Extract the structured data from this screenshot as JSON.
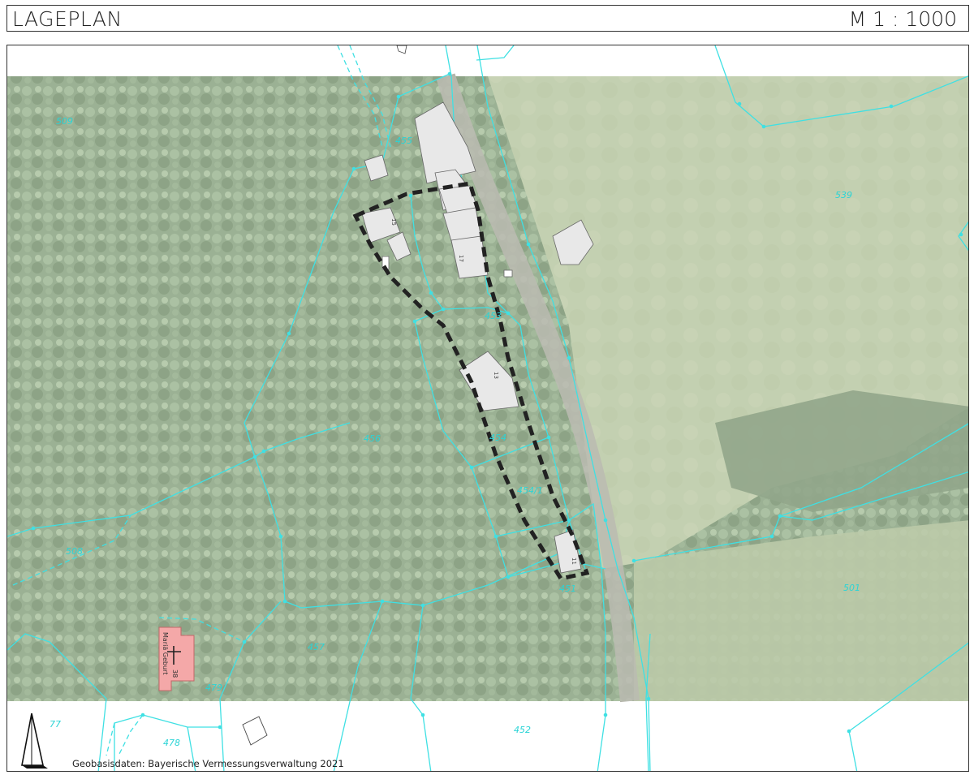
{
  "header": {
    "title": "LAGEPLAN",
    "scale": "M 1 : 1000"
  },
  "credit": "Geobasisdaten: Bayerische Vermessungsverwaltung 2021",
  "parcel_labels": [
    "509",
    "455",
    "539",
    "456",
    "454",
    "454/1",
    "501",
    "508",
    "457",
    "479",
    "478",
    "77",
    "452",
    "451",
    "453",
    "45"
  ],
  "house_numbers": [
    "15",
    "17",
    "13",
    "11",
    "38"
  ],
  "church": {
    "label": "Mariä Geburt",
    "number": "38"
  },
  "colors": {
    "parcel_lines": "#3fe0e3",
    "parcel_text": "#2bd4d6",
    "boundary": "#222222",
    "building": "#e6e6e6",
    "church": "#f4a8a8",
    "forest": "#7d9a72",
    "meadow": "#b7c79e"
  },
  "icons": {
    "north_arrow": "north-arrow-icon",
    "church_cross": "cross-icon"
  }
}
